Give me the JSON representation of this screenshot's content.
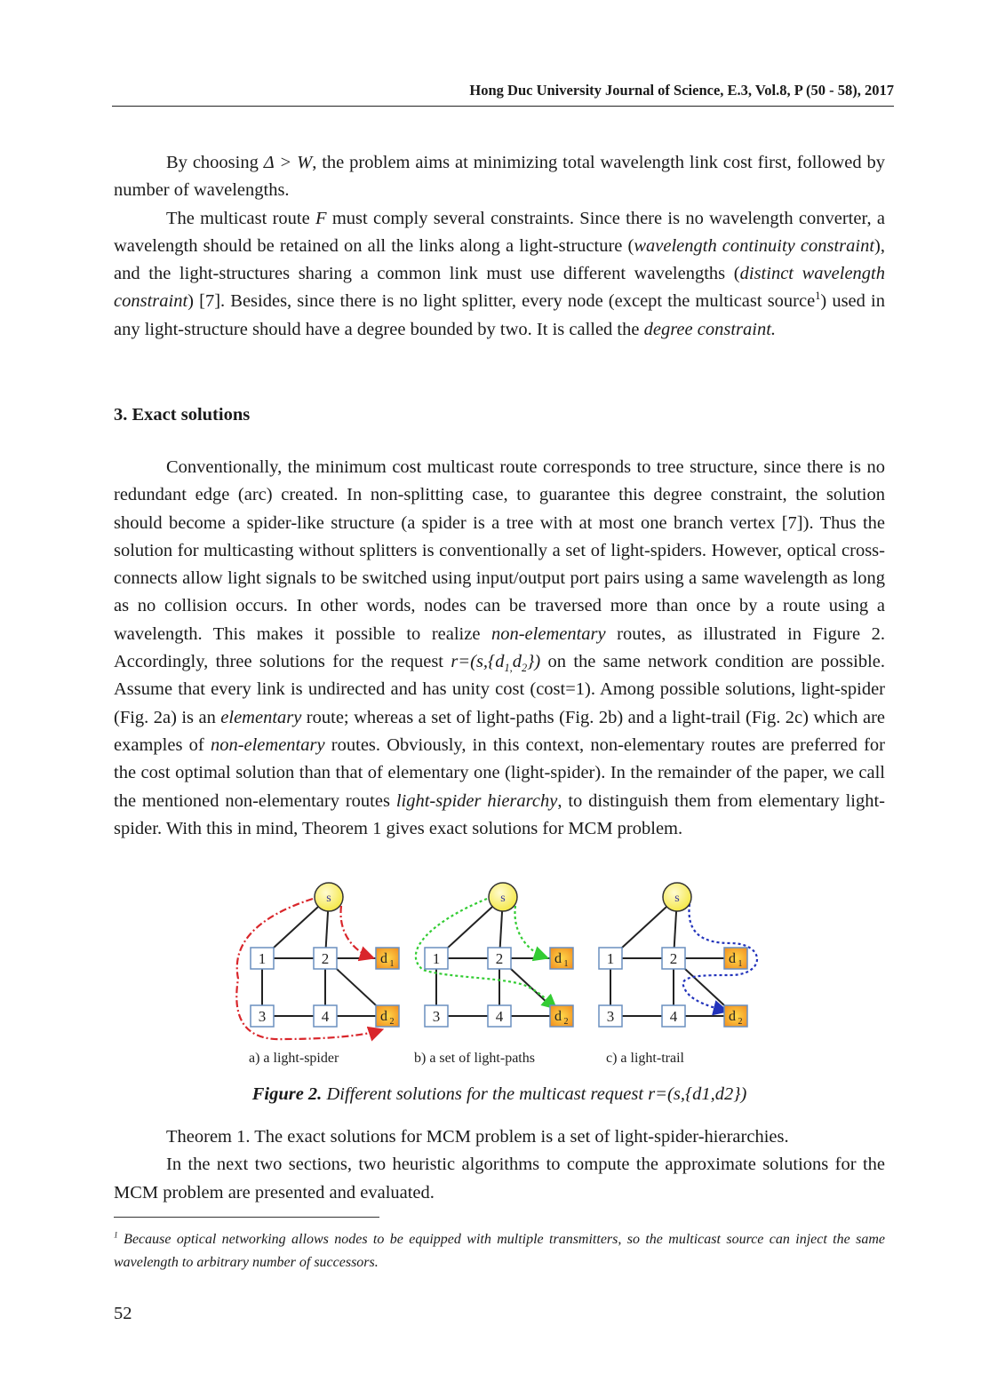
{
  "header": {
    "running_title": "Hong Duc University Journal of Science, E.3, Vol.8, P (50 - 58), 2017"
  },
  "paragraphs": {
    "p1_a": "By choosing ",
    "p1_math": "Δ > W",
    "p1_b": ", the problem aims at minimizing total wavelength link cost first, followed by number of wavelengths.",
    "p2_a": "The multicast route ",
    "p2_F": "F",
    "p2_b": " must comply several constraints. Since there is no wavelength converter, a wavelength should be retained on all the links along a light-structure (",
    "p2_em1": "wavelength continuity constraint",
    "p2_c": "), and the light-structures sharing a common link must use different wavelengths (",
    "p2_em2": "distinct wavelength constraint",
    "p2_d": ") [7]. Besides, since there is no light splitter, every node (except the multicast source",
    "p2_sup": "1",
    "p2_e": ") used in any light-structure should have a degree bounded by two. It is called the ",
    "p2_em3": "degree constraint."
  },
  "section": {
    "title": "3. Exact solutions"
  },
  "section_body": {
    "a": "Conventionally, the minimum cost multicast route corresponds to tree structure, since there is no redundant edge (arc) created. In non-splitting case, to guarantee this degree constraint, the solution should become a spider-like structure (a spider is a tree with at most one branch vertex [7]). Thus the solution for multicasting without splitters is conventionally a set of light-spiders. However, optical cross-connects allow light signals to be switched using input/output port pairs using a same wavelength as long as no collision occurs. In other words, nodes can be traversed more than once by a route using a wavelength. This makes it possible to realize ",
    "em_nonelem": "non-elementary",
    "b": " routes, as illustrated in Figure 2. Accordingly, three solutions for the request ",
    "req_r": "r=(s,{d",
    "req_sub1": "1,",
    "req_d": "d",
    "req_sub2": "2",
    "req_end": "})",
    "c": " on the same network condition are possible. Assume that every link is undirected and has unity cost (cost=1). Among possible solutions, light-spider (Fig. 2a) is an ",
    "em_elem": "elementary",
    "d": " route; whereas a set of light-paths (Fig. 2b) and a light-trail (Fig. 2c) which are examples of ",
    "em_nonelem2": "non-elementary",
    "e": " routes. Obviously, in this context, non-elementary routes are preferred for the cost optimal solution than that of elementary one (light-spider). In the remainder of the paper, we call the mentioned non-elementary routes ",
    "em_hier": "light-spider hierarchy",
    "f": ", to distinguish them from elementary light-spider. With this in mind, Theorem 1 gives exact solutions for MCM problem."
  },
  "figure": {
    "panels": [
      {
        "label": "a) a light-spider",
        "route_color": "#d9262b",
        "route_style": "dash-dot"
      },
      {
        "label": "b) a set of light-paths",
        "route_color": "#33cc33",
        "route_style": "dotted"
      },
      {
        "label": "c) a light-trail",
        "route_color": "#2233bb",
        "route_style": "dotted"
      }
    ],
    "nodes": {
      "source": "s",
      "n1": "1",
      "n2": "2",
      "n3": "3",
      "n4": "4",
      "d1": "d",
      "d1_sub": "1",
      "d2": "d",
      "d2_sub": "2"
    },
    "colors": {
      "source_fill": "#f5e84a",
      "dest_fill": "#f08a1e",
      "node_border": "#6a8fbf"
    }
  },
  "caption": {
    "label": "Figure 2.",
    "text": " Different solutions for the multicast request r=(s,{d1,d2})"
  },
  "after": {
    "theorem": "Theorem 1. The exact solutions for MCM problem is a set of light-spider-hierarchies.",
    "next": "In the next two sections, two heuristic algorithms to compute the approximate solutions for the MCM problem are presented and evaluated."
  },
  "footnote": {
    "mark": "1",
    "text": " Because optical networking allows nodes to be equipped with multiple transmitters, so the multicast source can inject the same wavelength to arbitrary number of successors."
  },
  "page_number": "52"
}
